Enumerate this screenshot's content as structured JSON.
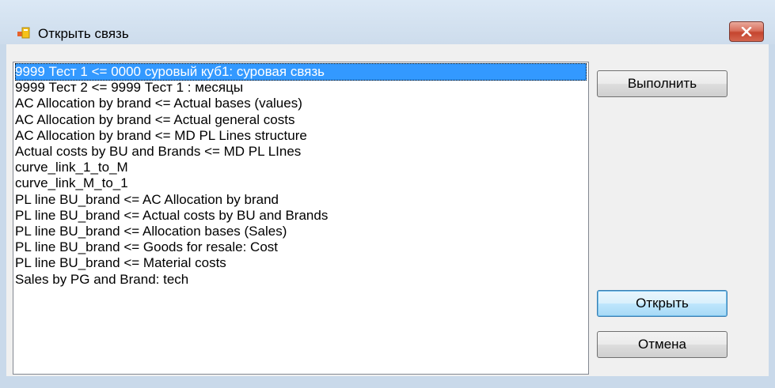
{
  "window": {
    "title": "Открыть связь",
    "icon": "app-window-icon",
    "close_icon": "close-icon"
  },
  "list": {
    "selected_index": 0,
    "items": [
      {
        "label": "9999 Тест 1 <= 0000 суровый куб1: суровая связь"
      },
      {
        "label": "9999 Тест 2 <= 9999 Тест 1 : месяцы"
      },
      {
        "label": "AC Allocation by brand <= Actual bases (values)"
      },
      {
        "label": "AC Allocation by brand <= Actual general costs"
      },
      {
        "label": "AC Allocation by brand <= MD PL Lines structure"
      },
      {
        "label": "Actual costs by BU and Brands <= MD PL LInes"
      },
      {
        "label": "curve_link_1_to_M"
      },
      {
        "label": "curve_link_M_to_1"
      },
      {
        "label": "PL line BU_brand <= AC Allocation by brand"
      },
      {
        "label": "PL line BU_brand <= Actual costs by BU and Brands"
      },
      {
        "label": "PL line BU_brand <= Allocation bases (Sales)"
      },
      {
        "label": "PL line BU_brand <= Goods for resale: Cost"
      },
      {
        "label": "PL line BU_brand <= Material costs"
      },
      {
        "label": "Sales by PG and Brand: tech"
      }
    ]
  },
  "buttons": {
    "execute": "Выполнить",
    "open": "Открыть",
    "cancel": "Отмена"
  },
  "colors": {
    "selection": "#3399ff",
    "frame": "#c9d9ea",
    "close_button": "#c5452f"
  }
}
